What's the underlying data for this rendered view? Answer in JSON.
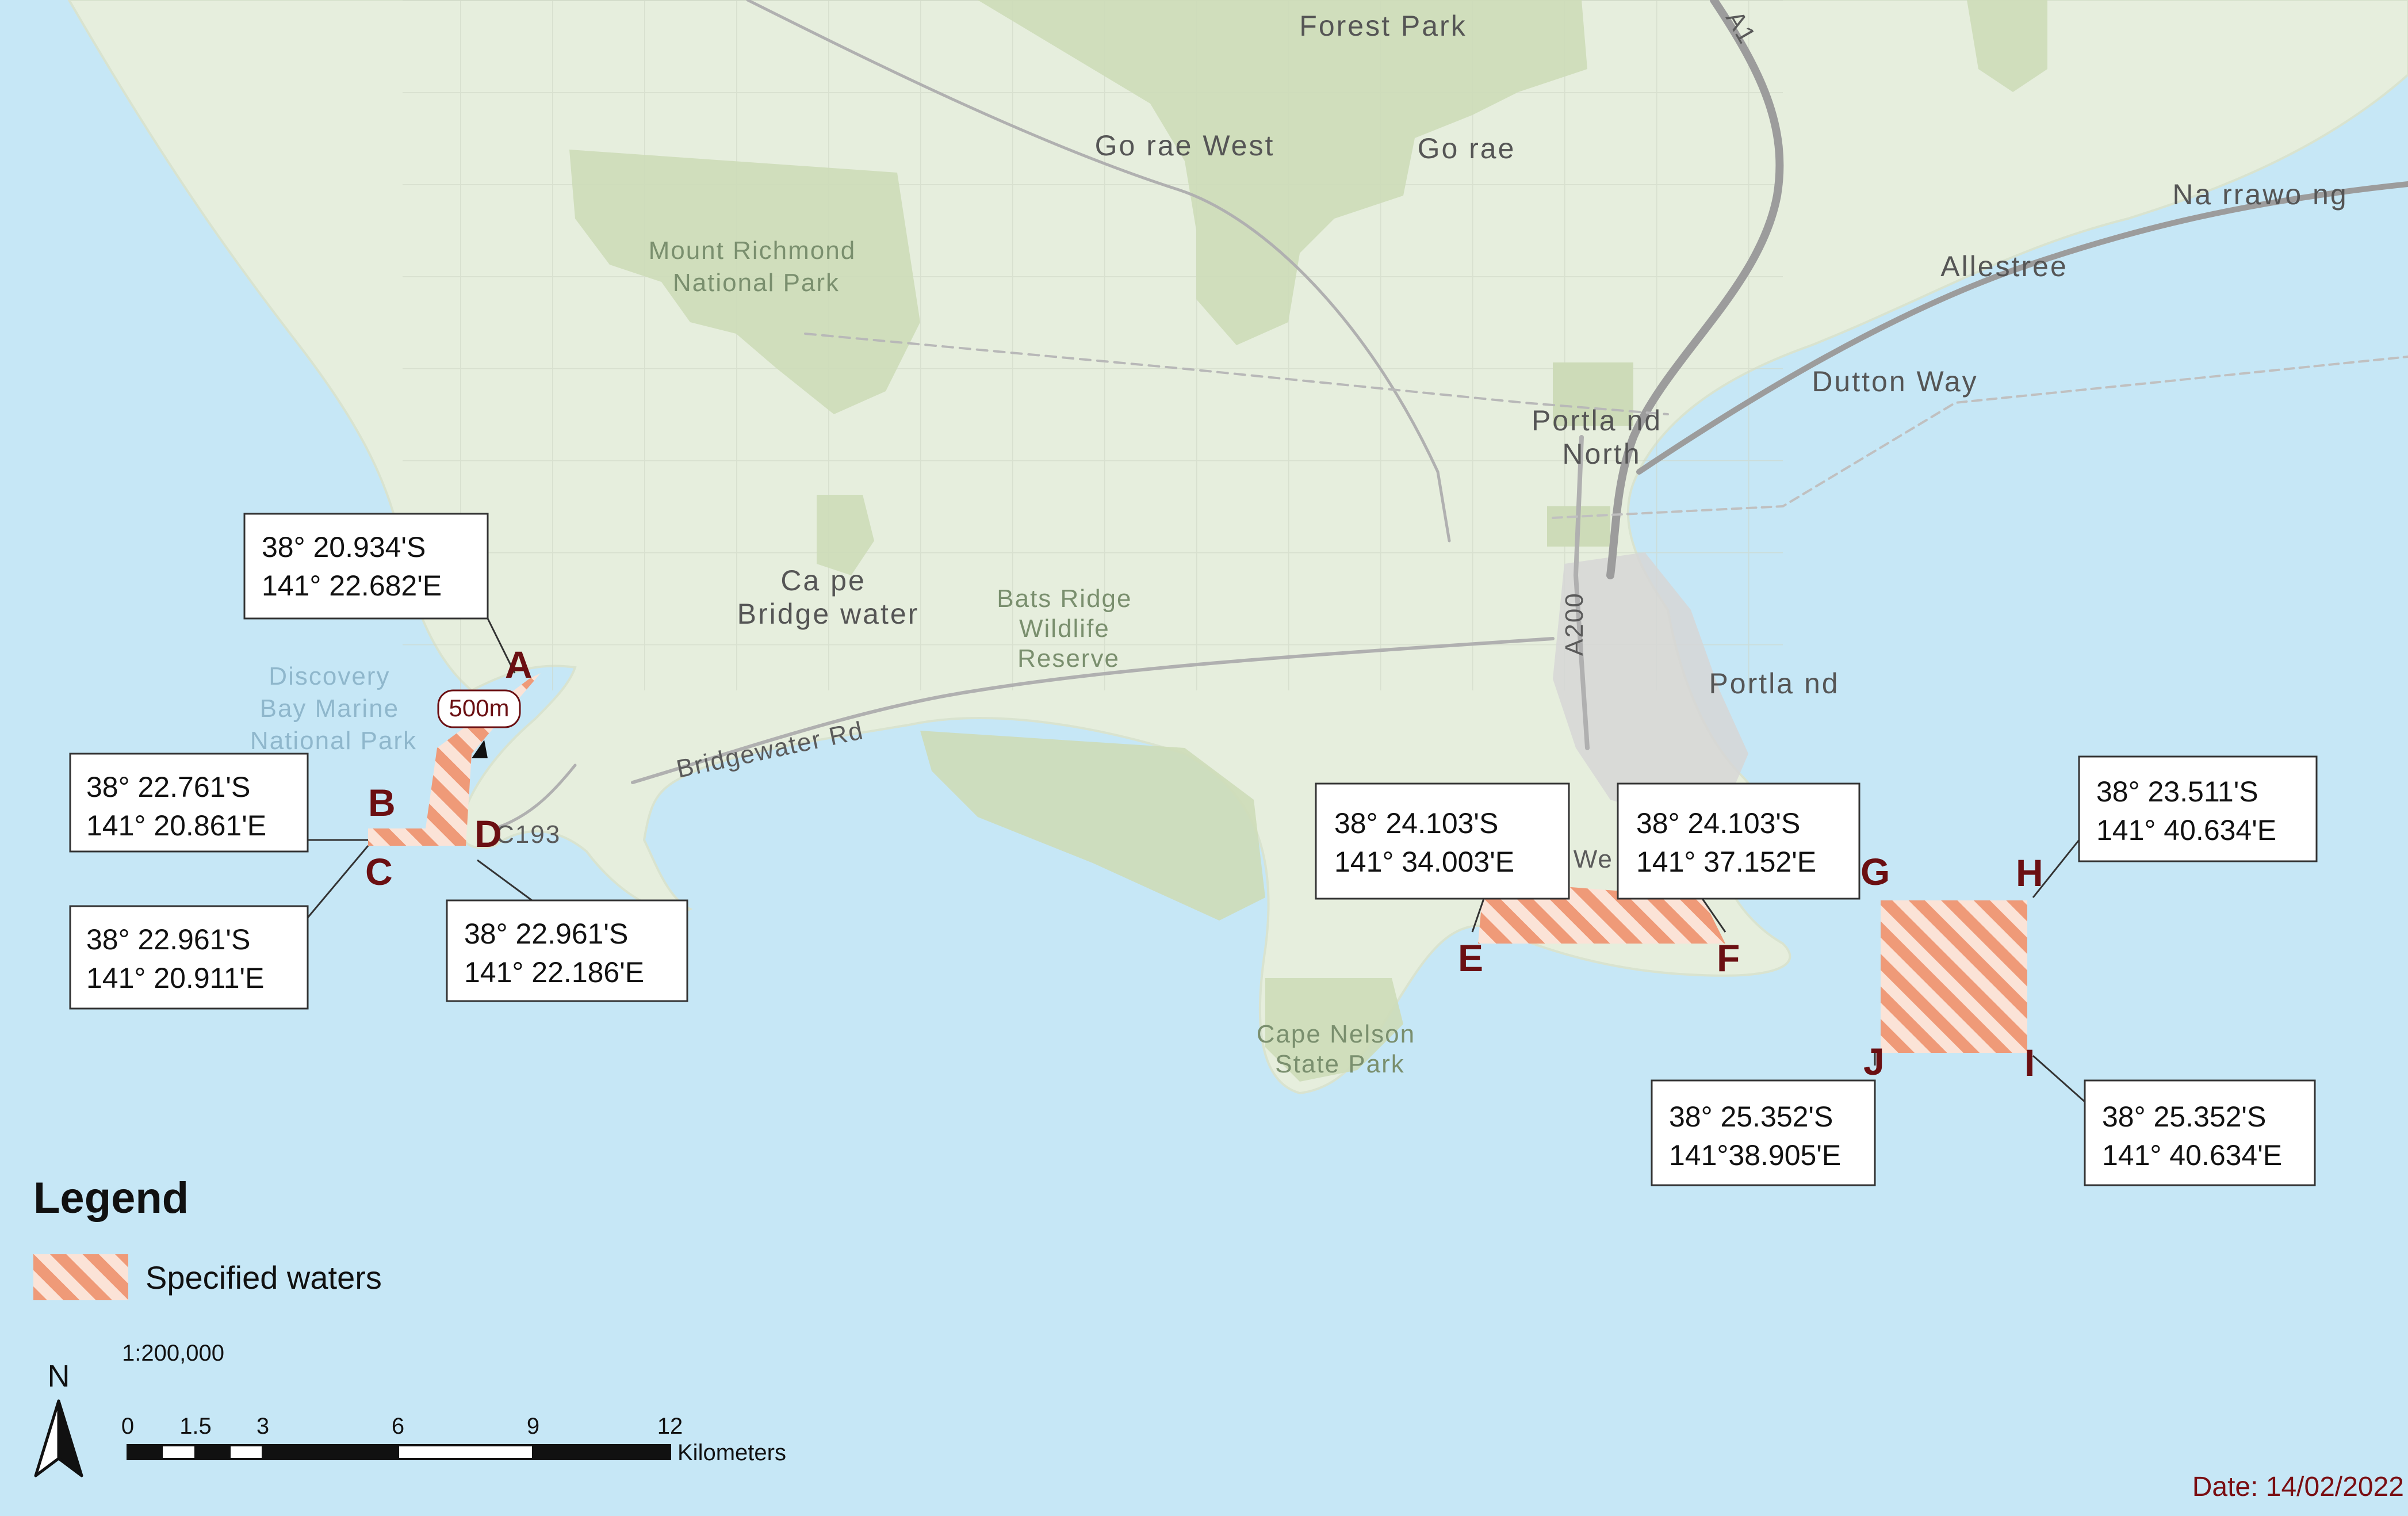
{
  "map": {
    "place_labels": {
      "forest_park": [
        "Forest Park"
      ],
      "gorae_west": [
        "Go rae West"
      ],
      "gorae": [
        "Go rae"
      ],
      "narrawong": [
        "Na rrawo ng"
      ],
      "allestree": [
        "Allestree"
      ],
      "dutton_way": [
        "Dutton Way"
      ],
      "portland_north": [
        "Portla nd",
        "North"
      ],
      "portland": [
        "Portla nd"
      ],
      "cape_bridgewater": [
        "Ca pe",
        "Bridge water"
      ],
      "mount_richmond": [
        "Mount Richmond",
        "National Park"
      ],
      "bats_ridge": [
        "Bats Ridge",
        "Wildlife",
        "Reserve"
      ],
      "discovery_bay": [
        "Discovery",
        "Bay Marine",
        "National Park"
      ],
      "cape_nelson": [
        "Cape Nelson",
        "State Park"
      ]
    },
    "road_labels": {
      "bridgewater_rd": "Bridgewater Rd",
      "a200": "A200",
      "a1": "A1",
      "c193": "C193",
      "west_partial": "d  We s"
    },
    "distance_label": "500m",
    "points": [
      "A",
      "B",
      "C",
      "D",
      "E",
      "F",
      "G",
      "H",
      "I",
      "J"
    ],
    "coordinates": {
      "A": [
        "38°    20.934'S",
        "141° 22.682'E"
      ],
      "B": [
        "38°    22.761'S",
        "141° 20.861'E"
      ],
      "C": [
        "38°    22.961'S",
        "141° 20.911'E"
      ],
      "D": [
        "38°    22.961'S",
        "141° 22.186'E"
      ],
      "E": [
        "38°    24.103'S",
        "141° 34.003'E"
      ],
      "F": [
        "38°    24.103'S",
        "141° 37.152'E"
      ],
      "H": [
        "38°    23.511'S",
        "141° 40.634'E"
      ],
      "J": [
        "38°    25.352'S",
        "141°38.905'E"
      ],
      "I": [
        "38°    25.352'S",
        "141° 40.634'E"
      ]
    },
    "colors": {
      "water": "#c6e7f6",
      "land": "#e6eedd",
      "park": "#cddbb8",
      "urban": "#d6d6d6",
      "hatch": "#ef9a78",
      "point_label": "#6b0f12",
      "road": "#b0b0b0"
    }
  },
  "legend": {
    "title": "Legend",
    "item_label": "Specified waters"
  },
  "scale": {
    "ratio": "1:200,000",
    "ticks": [
      "0",
      "1.5",
      "3",
      "6",
      "9",
      "12"
    ],
    "unit": "Kilometers"
  },
  "north_arrow": {
    "label": "N",
    "icon": "north-arrow-icon"
  },
  "date": "Date: 14/02/2022"
}
